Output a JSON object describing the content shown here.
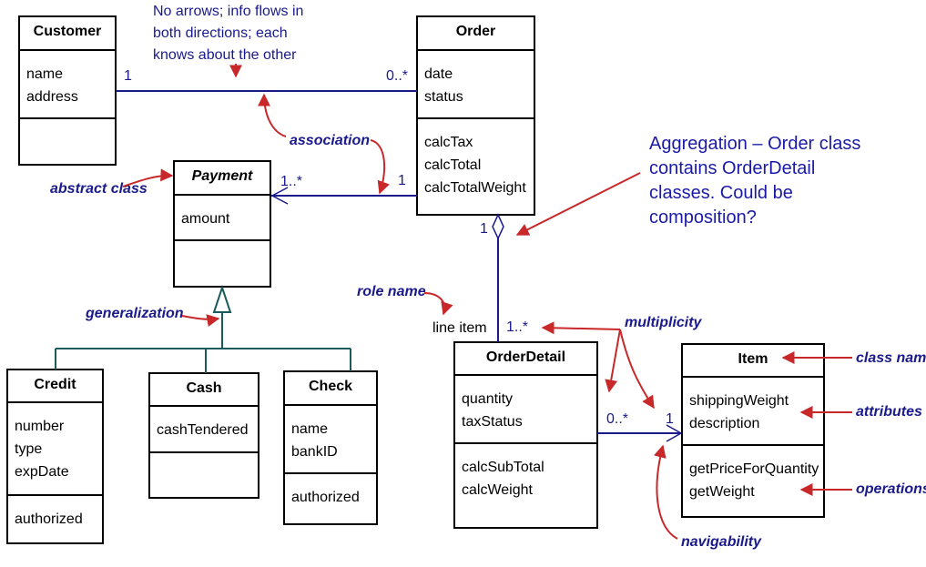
{
  "classes": [
    {
      "name": "Customer",
      "attributes": [
        "name",
        "address"
      ],
      "operations": []
    },
    {
      "name": "Order",
      "attributes": [
        "date",
        "status"
      ],
      "operations": [
        "calcTax",
        "calcTotal",
        "calcTotalWeight"
      ]
    },
    {
      "name": "Payment",
      "abstract": true,
      "attributes": [
        "amount"
      ],
      "operations": []
    },
    {
      "name": "Credit",
      "attributes": [
        "number",
        "type",
        "expDate"
      ],
      "operations": [
        "authorized"
      ]
    },
    {
      "name": "Cash",
      "attributes": [
        "cashTendered"
      ],
      "operations": []
    },
    {
      "name": "Check",
      "attributes": [
        "name",
        "bankID"
      ],
      "operations": [
        "authorized"
      ]
    },
    {
      "name": "OrderDetail",
      "attributes": [
        "quantity",
        "taxStatus"
      ],
      "operations": [
        "calcSubTotal",
        "calcWeight"
      ]
    },
    {
      "name": "Item",
      "attributes": [
        "shippingWeight",
        "description"
      ],
      "operations": [
        "getPriceForQuantity",
        "getWeight"
      ]
    }
  ],
  "multiplicities": {
    "customer_end": "1",
    "order_customer_end": "0..*",
    "payment_end": "1..*",
    "order_payment_end": "1",
    "order_aggregation_end": "1",
    "orderdetail_end": "1..*",
    "orderdetail_item_end": "0..*",
    "item_end": "1"
  },
  "role_name": "line item",
  "notes": {
    "association_note": [
      "No arrows; info flows in",
      "both directions; each",
      "knows about the other"
    ],
    "aggregation_note": [
      "Aggregation – Order class",
      "contains OrderDetail",
      "classes.  Could be",
      "composition?"
    ]
  },
  "labels": {
    "association": "association",
    "abstract_class": "abstract class",
    "generalization": "generalization",
    "role_name": "role name",
    "multiplicity": "multiplicity",
    "class_name": "class name",
    "attributes": "attributes",
    "operations": "operations",
    "navigability": "navigability"
  },
  "colors": {
    "line": "#1a1a8c",
    "annotation_arrow": "#c8282a",
    "text": "#1a1a8c"
  }
}
